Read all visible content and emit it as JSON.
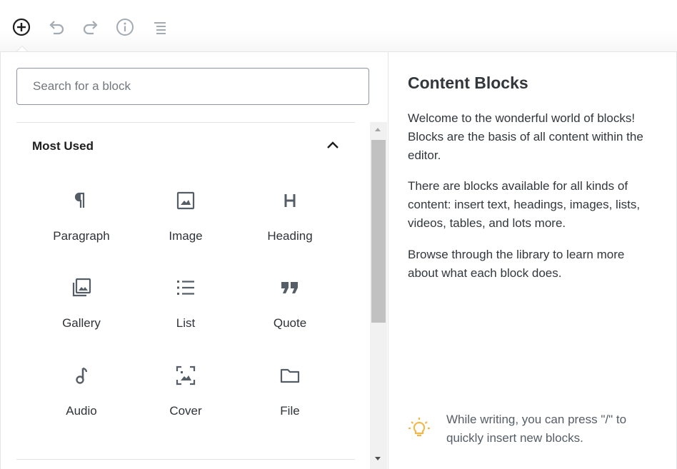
{
  "toolbar": {
    "buttons": [
      {
        "name": "add-block",
        "icon": "plus-circle-icon",
        "active": true
      },
      {
        "name": "undo",
        "icon": "undo-icon"
      },
      {
        "name": "redo",
        "icon": "redo-icon"
      },
      {
        "name": "info",
        "icon": "info-icon"
      },
      {
        "name": "outline",
        "icon": "block-navigation-icon"
      }
    ]
  },
  "inserter": {
    "search": {
      "placeholder": "Search for a block",
      "value": ""
    },
    "section": {
      "title": "Most Used",
      "expanded": true
    },
    "blocks": [
      {
        "label": "Paragraph",
        "icon": "paragraph-icon"
      },
      {
        "label": "Image",
        "icon": "image-icon"
      },
      {
        "label": "Heading",
        "icon": "heading-icon"
      },
      {
        "label": "Gallery",
        "icon": "gallery-icon"
      },
      {
        "label": "List",
        "icon": "list-icon"
      },
      {
        "label": "Quote",
        "icon": "quote-icon"
      },
      {
        "label": "Audio",
        "icon": "audio-icon"
      },
      {
        "label": "Cover",
        "icon": "cover-icon"
      },
      {
        "label": "File",
        "icon": "file-icon"
      }
    ]
  },
  "help": {
    "title": "Content Blocks",
    "paragraphs": [
      "Welcome to the wonderful world of blocks! Blocks are the basis of all content within the editor.",
      "There are blocks available for all kinds of content: insert text, headings, images, lists, videos, tables, and lots more.",
      "Browse through the library to learn more about what each block does."
    ],
    "tip": "While writing, you can press \"/\" to quickly insert new blocks."
  },
  "colors": {
    "icon": "#555d66",
    "active_icon": "#1e1e1e",
    "tip_icon": "#f0b849",
    "text": "#32373c"
  }
}
